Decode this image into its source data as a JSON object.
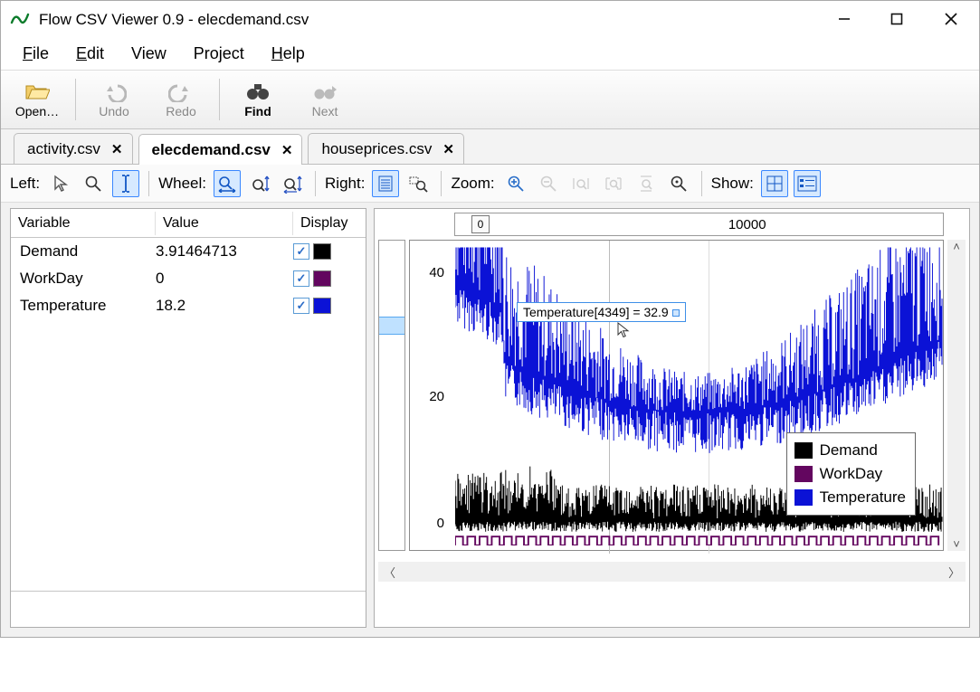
{
  "window": {
    "title": "Flow CSV Viewer 0.9 - elecdemand.csv"
  },
  "menubar": {
    "file": "File",
    "edit": "Edit",
    "view": "View",
    "project": "Project",
    "help": "Help"
  },
  "toolbar1": {
    "open": "Open…",
    "undo": "Undo",
    "redo": "Redo",
    "find": "Find",
    "next": "Next"
  },
  "tabs": [
    {
      "label": "activity.csv",
      "active": false
    },
    {
      "label": "elecdemand.csv",
      "active": true
    },
    {
      "label": "houseprices.csv",
      "active": false
    }
  ],
  "toolstrip": {
    "left_label": "Left:",
    "wheel_label": "Wheel:",
    "right_label": "Right:",
    "zoom_label": "Zoom:",
    "show_label": "Show:"
  },
  "vartable": {
    "headers": {
      "variable": "Variable",
      "value": "Value",
      "display": "Display"
    },
    "rows": [
      {
        "name": "Demand",
        "value": "3.91464713",
        "color": "#000000"
      },
      {
        "name": "WorkDay",
        "value": "0",
        "color": "#63065f"
      },
      {
        "name": "Temperature",
        "value": "18.2",
        "color": "#0b12d6"
      }
    ]
  },
  "chart": {
    "xticks": [
      {
        "label": "0",
        "frac": 0.0
      },
      {
        "label": "10000",
        "frac": 0.56
      }
    ],
    "yticks": [
      {
        "label": "40",
        "frac": 0.11
      },
      {
        "label": "20",
        "frac": 0.51
      },
      {
        "label": "0",
        "frac": 0.92
      }
    ],
    "tooltip": "Temperature[4349] = 32.9",
    "legend": [
      {
        "label": "Demand",
        "color": "#000000"
      },
      {
        "label": "WorkDay",
        "color": "#63065f"
      },
      {
        "label": "Temperature",
        "color": "#0b12d6"
      }
    ]
  },
  "ruler_knob": "0",
  "chart_data": {
    "type": "line",
    "title": "",
    "xlabel": "",
    "ylabel": "",
    "xlim": [
      0,
      17500
    ],
    "ylim": [
      0,
      45
    ],
    "series": [
      {
        "name": "Demand",
        "color": "#000000",
        "y_range_approx": [
          2,
          10
        ],
        "note": "dense noisy band along bottom, roughly 2–10 units"
      },
      {
        "name": "WorkDay",
        "color": "#63065f",
        "y_range_approx": [
          0,
          1.5
        ],
        "note": "square-wave near 0, short periodic pulses"
      },
      {
        "name": "Temperature",
        "color": "#0b12d6",
        "y_range_approx": [
          8,
          44
        ],
        "note": "highly variable; peaks ~44 early, trough ~10 around x≈9000, rising to ~35 near end; tooltip Temperature[4349]=32.9"
      }
    ]
  }
}
